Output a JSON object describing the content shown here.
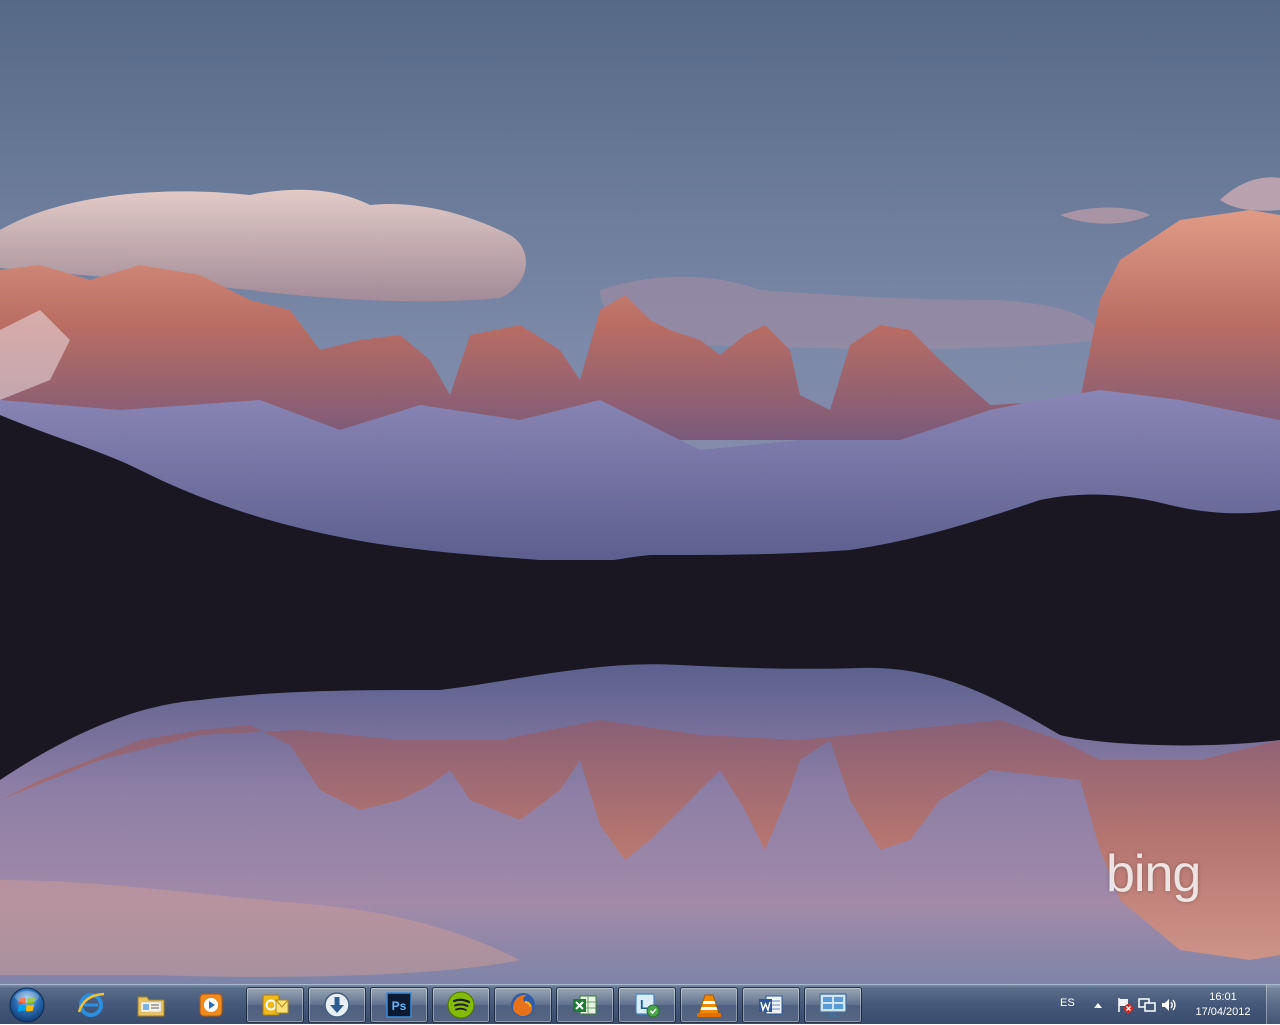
{
  "desktop": {
    "wallpaper": "dolomites-sunset-lake-reflection",
    "watermark": "bing"
  },
  "taskbar": {
    "start_icon": "windows-logo-icon",
    "buttons": [
      {
        "name": "internet-explorer-icon",
        "active": false
      },
      {
        "name": "windows-explorer-icon",
        "active": false
      },
      {
        "name": "windows-media-player-icon",
        "active": false
      },
      {
        "name": "outlook-icon",
        "active": true
      },
      {
        "name": "download-manager-icon",
        "active": true
      },
      {
        "name": "photoshop-icon",
        "active": true,
        "label": "Ps"
      },
      {
        "name": "spotify-icon",
        "active": true
      },
      {
        "name": "firefox-icon",
        "active": true
      },
      {
        "name": "excel-icon",
        "active": true
      },
      {
        "name": "lync-icon",
        "active": true
      },
      {
        "name": "vlc-icon",
        "active": true
      },
      {
        "name": "word-icon",
        "active": true
      },
      {
        "name": "remote-desktop-icon",
        "active": true
      }
    ],
    "tray": {
      "language": "ES",
      "icons": [
        "show-hidden-icons-icon",
        "action-center-icon",
        "network-icon",
        "volume-icon"
      ],
      "time": "16:01",
      "date": "17/04/2012"
    }
  },
  "colors": {
    "taskbar": "#45587a",
    "sky": "#6f7fa0",
    "rock": "#c2786a",
    "bing": "#ffffff"
  }
}
